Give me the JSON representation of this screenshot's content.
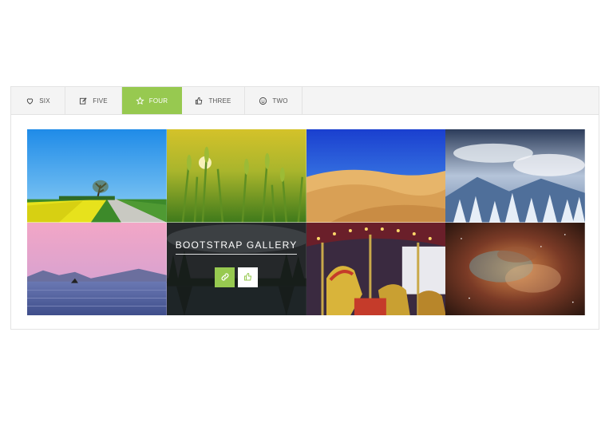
{
  "tabs": [
    {
      "label": "SIX",
      "icon": "heart-icon",
      "active": false
    },
    {
      "label": "FIVE",
      "icon": "edit-icon",
      "active": false
    },
    {
      "label": "FOUR",
      "icon": "star-icon",
      "active": true
    },
    {
      "label": "THREE",
      "icon": "thumbs-up-icon",
      "active": false
    },
    {
      "label": "TWO",
      "icon": "smile-icon",
      "active": false
    }
  ],
  "gallery": {
    "overlay_title": "BOOTSTRAP GALLERY",
    "images": [
      "road-field",
      "wheat",
      "desert",
      "snow-mountains",
      "lake-sunset",
      "forest-lake",
      "carousel",
      "nebula"
    ]
  },
  "colors": {
    "accent": "#97c950",
    "tabbar_bg": "#f4f4f4"
  }
}
